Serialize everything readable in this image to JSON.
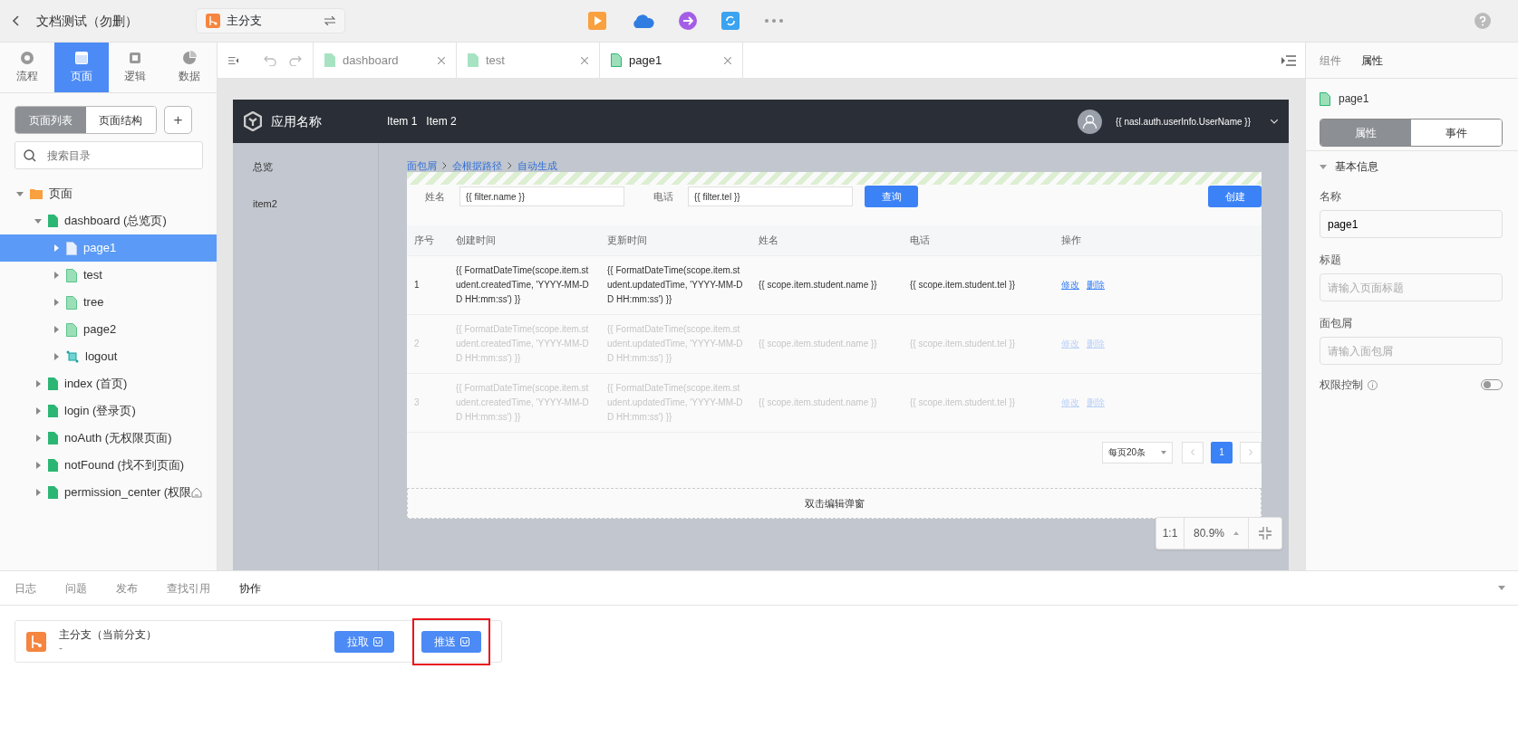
{
  "app_title": "文档测试（勿删）",
  "branch": {
    "name": "主分支"
  },
  "side_tabs": [
    {
      "label": "流程",
      "kind": "flow",
      "selected": false
    },
    {
      "label": "页面",
      "kind": "page",
      "selected": true
    },
    {
      "label": "逻辑",
      "kind": "logic",
      "selected": false
    },
    {
      "label": "数据",
      "kind": "data",
      "selected": false
    }
  ],
  "view_switch": [
    {
      "label": "页面列表",
      "selected": true
    },
    {
      "label": "页面结构",
      "selected": false
    }
  ],
  "add_button": "+",
  "search": {
    "placeholder": "搜索目录"
  },
  "tree": [
    {
      "label": "页面",
      "kind": "folder",
      "expanded": true,
      "selected": false,
      "children": [
        {
          "label": "dashboard (总览页)",
          "kind": "page",
          "expanded": true,
          "selected": false,
          "children": [
            {
              "label": "page1",
              "kind": "subpage",
              "expanded": false,
              "selected": true
            },
            {
              "label": "test",
              "kind": "subpage",
              "expanded": false,
              "selected": false
            },
            {
              "label": "tree",
              "kind": "subpage",
              "expanded": false,
              "selected": false
            },
            {
              "label": "page2",
              "kind": "subpage",
              "expanded": false,
              "selected": false
            },
            {
              "label": "logout",
              "kind": "logout",
              "expanded": false,
              "selected": false
            }
          ]
        },
        {
          "label": "index (首页)",
          "kind": "page",
          "expanded": false,
          "selected": false
        },
        {
          "label": "login (登录页)",
          "kind": "page",
          "expanded": false,
          "selected": false
        },
        {
          "label": "noAuth (无权限页面)",
          "kind": "page",
          "expanded": false,
          "selected": false
        },
        {
          "label": "notFound (找不到页面)",
          "kind": "page",
          "expanded": false,
          "selected": false
        },
        {
          "label": "permission_center (权限",
          "kind": "page",
          "expanded": false,
          "selected": false,
          "home": true
        }
      ]
    }
  ],
  "editor_tabs": [
    {
      "label": "dashboard",
      "selected": false
    },
    {
      "label": "test",
      "selected": false
    },
    {
      "label": "page1",
      "selected": true
    }
  ],
  "preview": {
    "app_name": "应用名称",
    "nav": [
      "Item 1",
      "Item 2"
    ],
    "user": "{{ nasl.auth.userInfo.UserName }}",
    "menu": [
      "总览",
      "item2"
    ],
    "breadcrumb": [
      "面包屑",
      "会根据路径",
      "自动生成"
    ],
    "filters": [
      {
        "label": "姓名",
        "value": "{{ filter.name }}"
      },
      {
        "label": "电话",
        "value": "{{ filter.tel }}"
      }
    ],
    "query_button": "查询",
    "create_button": "创建",
    "table": {
      "columns": [
        "序号",
        "创建时间",
        "更新时间",
        "姓名",
        "电话",
        "操作"
      ],
      "rows": [
        {
          "disabled": false,
          "cells": [
            "1",
            "{{ FormatDateTime(scope.item.student.createdTime, 'YYYY-MM-DD HH:mm:ss') }}",
            "{{ FormatDateTime(scope.item.student.updatedTime, 'YYYY-MM-DD HH:mm:ss') }}",
            "{{ scope.item.student.name }}",
            "{{ scope.item.student.tel }}"
          ],
          "actions": [
            "修改",
            "删除"
          ]
        },
        {
          "disabled": true,
          "cells": [
            "2",
            "{{ FormatDateTime(scope.item.student.createdTime, 'YYYY-MM-DD HH:mm:ss') }}",
            "{{ FormatDateTime(scope.item.student.updatedTime, 'YYYY-MM-DD HH:mm:ss') }}",
            "{{ scope.item.student.name }}",
            "{{ scope.item.student.tel }}"
          ],
          "actions": [
            "修改",
            "删除"
          ]
        },
        {
          "disabled": true,
          "cells": [
            "3",
            "{{ FormatDateTime(scope.item.student.createdTime, 'YYYY-MM-DD HH:mm:ss') }}",
            "{{ FormatDateTime(scope.item.student.updatedTime, 'YYYY-MM-DD HH:mm:ss') }}",
            "{{ scope.item.student.name }}",
            "{{ scope.item.student.tel }}"
          ],
          "actions": [
            "修改",
            "删除"
          ]
        }
      ]
    },
    "page_size": "每页20条",
    "pages": [
      {
        "label": "1",
        "selected": true
      }
    ],
    "modal_hint": "双击编辑弹窗"
  },
  "zoom": {
    "reset": "1:1",
    "value": "80.9%"
  },
  "right_tabs": [
    {
      "label": "组件",
      "selected": false
    },
    {
      "label": "属性",
      "selected": true
    }
  ],
  "component": "page1",
  "prop_switch": [
    {
      "label": "属性",
      "selected": true
    },
    {
      "label": "事件",
      "selected": false
    }
  ],
  "section": {
    "title": "基本信息",
    "expanded": true
  },
  "fields": [
    {
      "label": "名称",
      "value": "page1"
    },
    {
      "label": "标题",
      "placeholder": "请输入页面标题"
    },
    {
      "label": "面包屑",
      "placeholder": "请输入面包屑"
    }
  ],
  "toggle": {
    "label": "权限控制",
    "on": false
  },
  "bottom_tabs": [
    {
      "label": "日志",
      "selected": false
    },
    {
      "label": "问题",
      "selected": false
    },
    {
      "label": "发布",
      "selected": false
    },
    {
      "label": "查找引用",
      "selected": false
    },
    {
      "label": "协作",
      "selected": true
    }
  ],
  "branch_card": {
    "name": "主分支（当前分支）",
    "note": "-",
    "buttons": [
      {
        "label": "拉取",
        "highlighted": false
      },
      {
        "label": "推送",
        "highlighted": true
      }
    ]
  }
}
